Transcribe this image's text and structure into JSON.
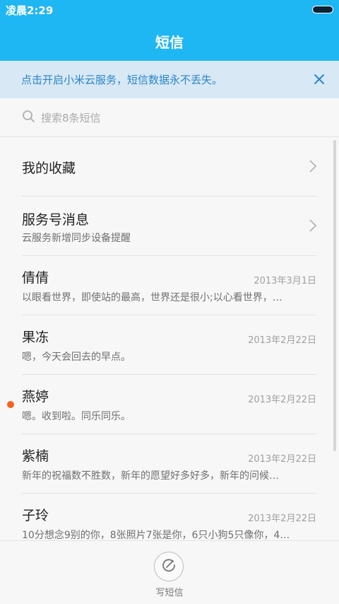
{
  "status": {
    "time": "凌晨2:29"
  },
  "header": {
    "title": "短信"
  },
  "banner": {
    "text": "点击开启小米云服务，短信数据永不丢失。"
  },
  "search": {
    "placeholder": "搜索8条短信"
  },
  "list": {
    "favorites": {
      "name": "我的收藏"
    },
    "service": {
      "name": "服务号消息",
      "sub": "云服务新增同步设备提醒"
    },
    "conversations": [
      {
        "name": "倩倩",
        "date": "2013年3月1日",
        "snippet": "以眼看世界，即使站的最高，世界还是很小;以心看世界，…",
        "unread": false
      },
      {
        "name": "果冻",
        "date": "2013年2月22日",
        "snippet": "嗯，今天会回去的早点。",
        "unread": false
      },
      {
        "name": "燕婷",
        "date": "2013年2月22日",
        "snippet": "嗯。收到啦。同乐同乐。",
        "unread": true
      },
      {
        "name": "紫楠",
        "date": "2013年2月22日",
        "snippet": "新年的祝福数不胜数，新年的愿望好多好多，新年的问候…",
        "unread": false
      },
      {
        "name": "子玲",
        "date": "2013年2月22日",
        "snippet": "10分想念9别的你，8张照片7张是你，6只小狗5只像你，4…",
        "unread": false
      }
    ]
  },
  "bottom": {
    "compose_label": "写短信"
  },
  "colors": {
    "accent": "#1fb6f4",
    "banner_bg": "#d8e8f4",
    "banner_text": "#2a86c8",
    "unread_dot": "#f5621d"
  },
  "icons": {
    "close": "close-icon",
    "search": "search-icon",
    "chevron": "chevron-right-icon",
    "compose": "compose-icon"
  }
}
